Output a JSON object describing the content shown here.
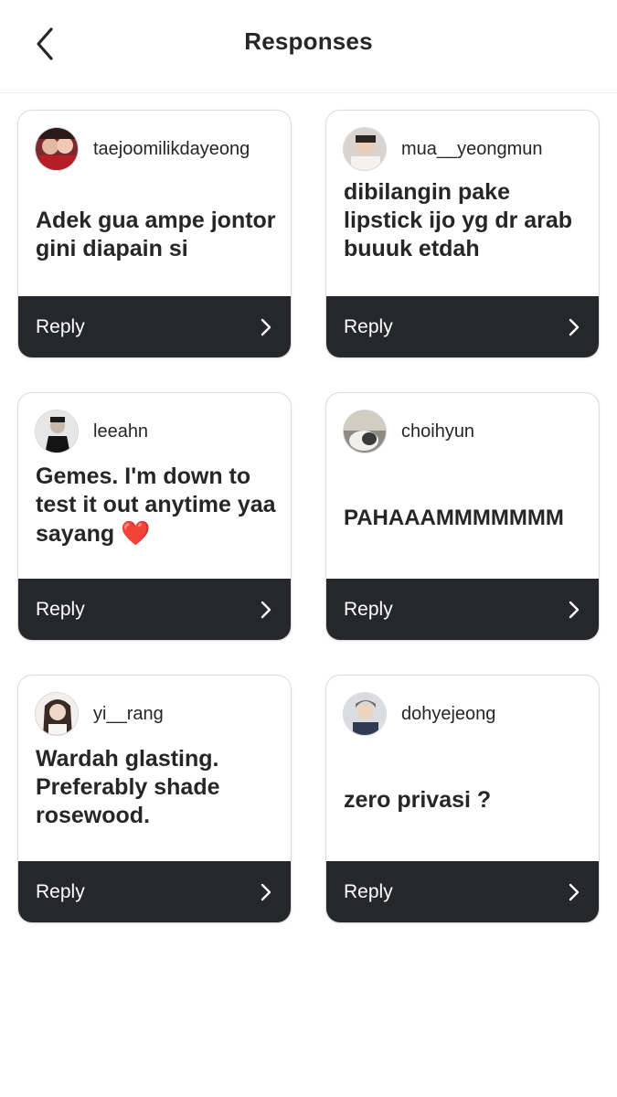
{
  "header": {
    "title": "Responses",
    "back_icon": "chevron-left-icon"
  },
  "responses": [
    {
      "username": "taejoomilikdayeong",
      "text": "Adek gua ampe jontor gini diapain si",
      "reply_label": "Reply"
    },
    {
      "username": "mua__yeongmun",
      "text": "dibilangin pake lipstick ijo yg dr arab buuuk etdah",
      "reply_label": "Reply"
    },
    {
      "username": "leeahn",
      "text": "Gemes. I'm down to test it out anytime yaa sayang",
      "emoji": "❤️",
      "reply_label": "Reply"
    },
    {
      "username": "choihyun",
      "text": "PAHAAAMMMMMMM",
      "reply_label": "Reply"
    },
    {
      "username": "yi__rang",
      "text": "Wardah glasting. Preferably shade rosewood.",
      "reply_label": "Reply"
    },
    {
      "username": "dohyejeong",
      "text": "zero privasi ?",
      "reply_label": "Reply"
    }
  ],
  "colors": {
    "reply_bar": "#25272b",
    "heart": "#ed1c24",
    "text": "#262626"
  }
}
